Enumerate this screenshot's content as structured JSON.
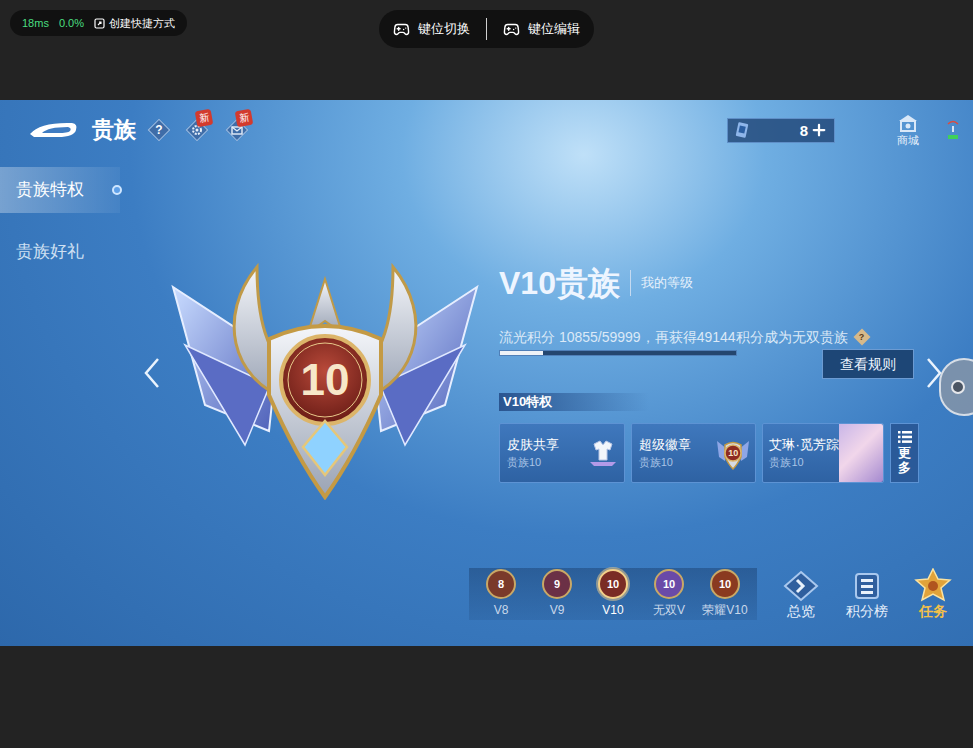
{
  "overlay_bar": {
    "ping": "18ms",
    "loss": "0.0%",
    "shortcut": "创建快捷方式"
  },
  "key_menu": [
    {
      "label": "键位切换"
    },
    {
      "label": "键位编辑"
    }
  ],
  "header": {
    "title": "贵族",
    "help": "?",
    "icons": [
      {
        "kind": "gear",
        "badge": "新"
      },
      {
        "kind": "mail",
        "badge": "新"
      }
    ],
    "tickets": {
      "count": "8"
    },
    "shop": "商城"
  },
  "sidebar": {
    "items": [
      {
        "label": "贵族特权",
        "selected": true
      },
      {
        "label": "贵族好礼",
        "selected": false
      }
    ]
  },
  "emblem": {
    "number": "10"
  },
  "level": {
    "title": "V10贵族",
    "subtitle": "我的等级",
    "points_text": "流光积分 10855/59999，再获得49144积分成为无双贵族",
    "help": "?",
    "level": 0.181,
    "rules_button": "查看规则"
  },
  "privileges": {
    "title": "V10特权",
    "cards": [
      {
        "kind": "skin",
        "name": "皮肤共享",
        "req": "贵族10"
      },
      {
        "kind": "badge",
        "name": "超级徽章",
        "req": "贵族10",
        "badge": "10"
      },
      {
        "kind": "hero",
        "name": "艾琳·觅芳踪",
        "req": "贵族10"
      }
    ],
    "more": "更多"
  },
  "level_tabs": [
    {
      "label": "V8",
      "badge": "8",
      "selected": false,
      "color": "#7a3a2a"
    },
    {
      "label": "V9",
      "badge": "9",
      "selected": false,
      "color": "#6b3046"
    },
    {
      "label": "V10",
      "badge": "10",
      "selected": true,
      "color": "#7a2c25"
    },
    {
      "label": "无双V",
      "badge": "10",
      "selected": false,
      "color": "#6a4aa8"
    },
    {
      "label": "荣耀V10",
      "badge": "10",
      "selected": false,
      "color": "#8a3a20"
    }
  ],
  "nav": [
    {
      "kind": "overview",
      "label": "总览"
    },
    {
      "kind": "ranking",
      "label": "积分榜"
    },
    {
      "kind": "task",
      "label": "任务"
    }
  ]
}
